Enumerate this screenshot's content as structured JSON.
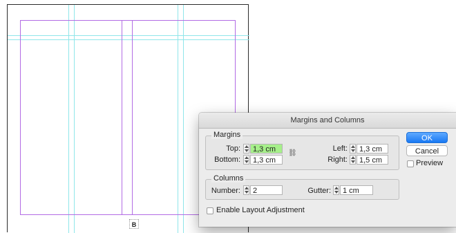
{
  "canvas": {
    "page_label": "B",
    "colors": {
      "margin_guide": "#b26be4",
      "ruler_guide": "#8fe6ea"
    }
  },
  "dialog": {
    "title": "Margins and Columns",
    "margins": {
      "group_title": "Margins",
      "top_label": "Top:",
      "top_value": "1,3 cm",
      "bottom_label": "Bottom:",
      "bottom_value": "1,3 cm",
      "left_label": "Left:",
      "left_value": "1,3 cm",
      "right_label": "Right:",
      "right_value": "1,5 cm",
      "link_icon": "chain-link-icon"
    },
    "columns": {
      "group_title": "Columns",
      "number_label": "Number:",
      "number_value": "2",
      "gutter_label": "Gutter:",
      "gutter_value": "1 cm"
    },
    "enable_layout_adjustment": {
      "label": "Enable Layout Adjustment",
      "checked": false
    },
    "buttons": {
      "ok": "OK",
      "cancel": "Cancel"
    },
    "preview": {
      "label": "Preview",
      "checked": false
    },
    "colors": {
      "accent": "#1978f3",
      "field_highlight": "#a6f08a"
    }
  }
}
